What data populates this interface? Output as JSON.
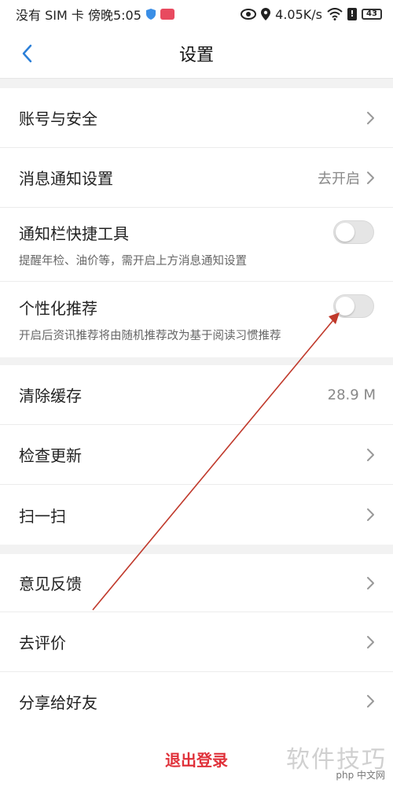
{
  "status_bar": {
    "carrier_time": "没有 SIM 卡 傍晚5:05",
    "speed": "4.05K/s",
    "battery": "43"
  },
  "header": {
    "title": "设置"
  },
  "section1": {
    "account": {
      "label": "账号与安全"
    },
    "notify": {
      "label": "消息通知设置",
      "value": "去开启"
    },
    "quick_tools": {
      "label": "通知栏快捷工具",
      "sub": "提醒年检、油价等，需开启上方消息通知设置",
      "enabled": false
    },
    "personalized": {
      "label": "个性化推荐",
      "sub": "开启后资讯推荐将由随机推荐改为基于阅读习惯推荐",
      "enabled": false
    }
  },
  "section2": {
    "cache": {
      "label": "清除缓存",
      "value": "28.9 M"
    },
    "update": {
      "label": "检查更新"
    },
    "scan": {
      "label": "扫一扫"
    }
  },
  "section3": {
    "feedback": {
      "label": "意见反馈"
    },
    "rate": {
      "label": "去评价"
    },
    "share": {
      "label": "分享给好友"
    }
  },
  "logout": {
    "label": "退出登录"
  },
  "watermark": {
    "text": "软件技巧",
    "site": "php 中文网"
  },
  "colors": {
    "logout": "#e0313a",
    "accent_back": "#2b7fd8",
    "annotation_arrow": "#c0392b"
  }
}
